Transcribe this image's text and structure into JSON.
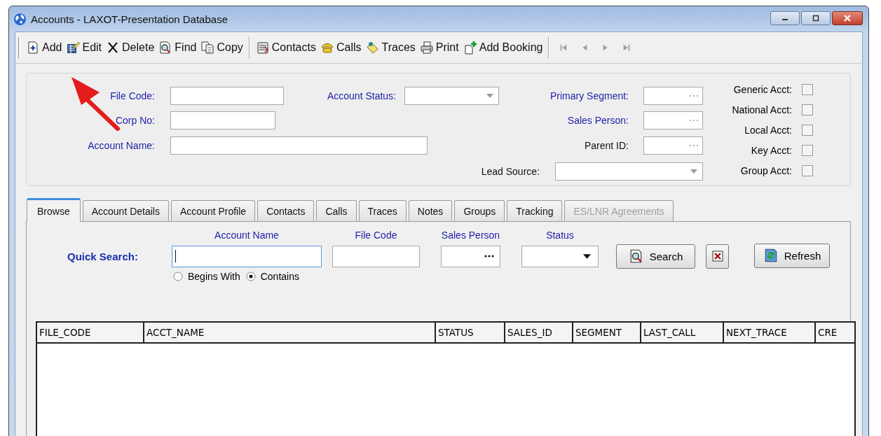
{
  "window": {
    "title": "Accounts - LAXOT-Presentation Database"
  },
  "toolbar": {
    "groups": [
      [
        {
          "label": "Add"
        },
        {
          "label": "Edit"
        },
        {
          "label": "Delete"
        },
        {
          "label": "Find"
        },
        {
          "label": "Copy"
        }
      ],
      [
        {
          "label": "Contacts"
        },
        {
          "label": "Calls"
        },
        {
          "label": "Traces"
        },
        {
          "label": "Print"
        },
        {
          "label": "Add Booking"
        }
      ]
    ],
    "nav": [
      {
        "disabled": true
      },
      {
        "disabled": true
      },
      {
        "disabled": true
      },
      {
        "disabled": true
      }
    ]
  },
  "header_form": {
    "file_code": {
      "label": "File Code:",
      "required": true
    },
    "corp_no": {
      "label": "Corp No:",
      "required": true
    },
    "account_name": {
      "label": "Account Name:",
      "required": true
    },
    "account_status": {
      "label": "Account Status:",
      "required": true
    },
    "primary_segment": {
      "label": "Primary Segment:",
      "required": true
    },
    "sales_person": {
      "label": "Sales Person:",
      "required": true
    },
    "parent_id": {
      "label": "Parent ID:",
      "required": false
    },
    "lead_source": {
      "label": "Lead Source:",
      "required": false
    },
    "flags": [
      {
        "label": "Generic Acct:",
        "checked": false
      },
      {
        "label": "National Acct:",
        "checked": false
      },
      {
        "label": "Local Acct:",
        "checked": false
      },
      {
        "label": "Key Acct:",
        "checked": false
      },
      {
        "label": "Group Acct:",
        "checked": false
      }
    ]
  },
  "tabs": [
    {
      "label": "Browse",
      "selected": true,
      "disabled": false
    },
    {
      "label": "Account Details",
      "selected": false,
      "disabled": false
    },
    {
      "label": "Account Profile",
      "selected": false,
      "disabled": false
    },
    {
      "label": "Contacts",
      "selected": false,
      "disabled": false
    },
    {
      "label": "Calls",
      "selected": false,
      "disabled": false
    },
    {
      "label": "Traces",
      "selected": false,
      "disabled": false
    },
    {
      "label": "Notes",
      "selected": false,
      "disabled": false
    },
    {
      "label": "Groups",
      "selected": false,
      "disabled": false
    },
    {
      "label": "Tracking",
      "selected": false,
      "disabled": false
    },
    {
      "label": "ES/LNR Agreements",
      "selected": false,
      "disabled": true
    }
  ],
  "quick_search": {
    "label": "Quick Search:",
    "account_name": {
      "header": "Account Name"
    },
    "file_code": {
      "header": "File Code"
    },
    "sales_person": {
      "header": "Sales Person"
    },
    "status": {
      "header": "Status"
    },
    "match": [
      {
        "label": "Begins With",
        "selected": false
      },
      {
        "label": "Contains",
        "selected": true
      }
    ],
    "search_button": "Search",
    "refresh_button": "Refresh"
  },
  "grid": {
    "columns": [
      "FILE_CODE",
      "ACCT_NAME",
      "STATUS",
      "SALES_ID",
      "SEGMENT",
      "LAST_CALL",
      "NEXT_TRACE",
      "CRE"
    ]
  }
}
